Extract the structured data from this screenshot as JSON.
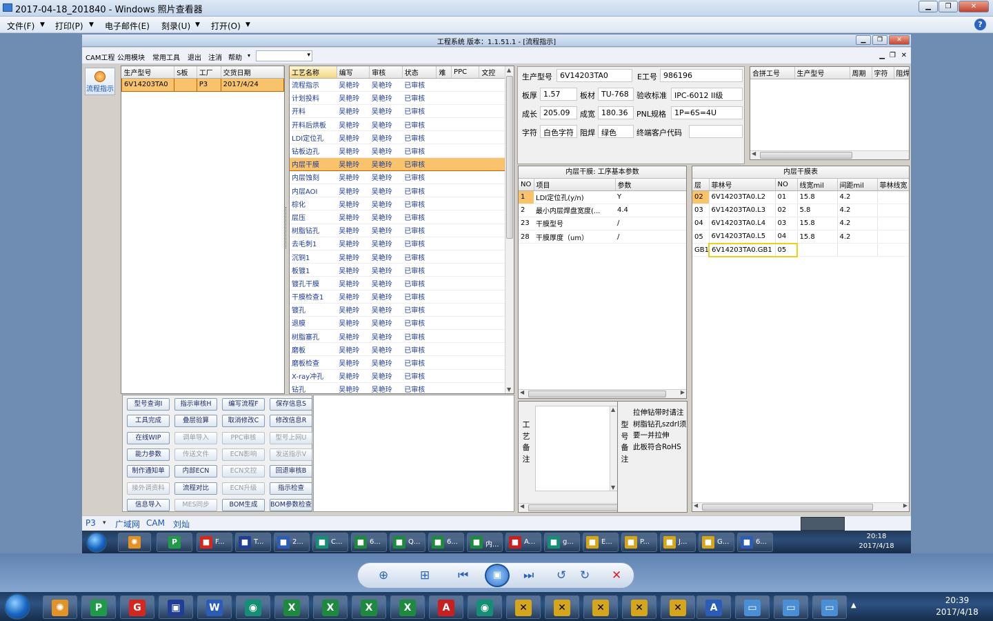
{
  "viewer": {
    "title": "2017-04-18_201840 - Windows 照片查看器",
    "menu": [
      "文件(F)",
      "打印(P)",
      "电子邮件(E)",
      "刻录(U)",
      "打开(O)"
    ]
  },
  "app": {
    "title": "工程系统  版本：1.1.51.1 - [流程指示]",
    "menu": [
      "CAM工程",
      "公用模块",
      "常用工具",
      "退出",
      "注消",
      "帮助"
    ],
    "side_button": "流程指示",
    "order": {
      "headers": [
        "生产型号",
        "S板",
        "工厂",
        "交货日期"
      ],
      "rows": [
        [
          "6V14203TA0",
          "",
          "P3",
          "2017/4/24"
        ]
      ]
    },
    "process": {
      "headers": [
        "工艺名称",
        "编写",
        "审核",
        "状态",
        "难",
        "PPC",
        "文控"
      ],
      "rows": [
        [
          "流程指示",
          "吴艳玲",
          "吴艳玲",
          "已审核"
        ],
        [
          "计划投料",
          "吴艳玲",
          "吴艳玲",
          "已审核"
        ],
        [
          "开料",
          "吴艳玲",
          "吴艳玲",
          "已审核"
        ],
        [
          "开料后烘板",
          "吴艳玲",
          "吴艳玲",
          "已审核"
        ],
        [
          "LDI定位孔",
          "吴艳玲",
          "吴艳玲",
          "已审核"
        ],
        [
          "钻板边孔",
          "吴艳玲",
          "吴艳玲",
          "已审核"
        ],
        [
          "内层干膜",
          "吴艳玲",
          "吴艳玲",
          "已审核"
        ],
        [
          "内层蚀刻",
          "吴艳玲",
          "吴艳玲",
          "已审核"
        ],
        [
          "内层AOI",
          "吴艳玲",
          "吴艳玲",
          "已审核"
        ],
        [
          "棕化",
          "吴艳玲",
          "吴艳玲",
          "已审核"
        ],
        [
          "层压",
          "吴艳玲",
          "吴艳玲",
          "已审核"
        ],
        [
          "树脂钻孔",
          "吴艳玲",
          "吴艳玲",
          "已审核"
        ],
        [
          "去毛刺1",
          "吴艳玲",
          "吴艳玲",
          "已审核"
        ],
        [
          "沉铜1",
          "吴艳玲",
          "吴艳玲",
          "已审核"
        ],
        [
          "板镀1",
          "吴艳玲",
          "吴艳玲",
          "已审核"
        ],
        [
          "镀孔干膜",
          "吴艳玲",
          "吴艳玲",
          "已审核"
        ],
        [
          "干膜检查1",
          "吴艳玲",
          "吴艳玲",
          "已审核"
        ],
        [
          "镀孔",
          "吴艳玲",
          "吴艳玲",
          "已审核"
        ],
        [
          "退膜",
          "吴艳玲",
          "吴艳玲",
          "已审核"
        ],
        [
          "树脂塞孔",
          "吴艳玲",
          "吴艳玲",
          "已审核"
        ],
        [
          "磨板",
          "吴艳玲",
          "吴艳玲",
          "已审核"
        ],
        [
          "磨板检查",
          "吴艳玲",
          "吴艳玲",
          "已审核"
        ],
        [
          "X-ray冲孔",
          "吴艳玲",
          "吴艳玲",
          "已审核"
        ],
        [
          "钻孔",
          "吴艳玲",
          "吴艳玲",
          "已审核"
        ]
      ],
      "selected_index": 6
    },
    "buttons": [
      [
        "型号查询I",
        "指示审核H",
        "编写流程F",
        "保存信息S"
      ],
      [
        "工具完成",
        "叠层验算",
        "取消修改C",
        "修改信息R"
      ],
      [
        "在线WIP",
        "调单导入",
        "PPC审核",
        "型号上网U"
      ],
      [
        "能力参数",
        "传送文件",
        "ECN影响",
        "发送指示V"
      ],
      [
        "制作通知单",
        "内部ECN",
        "ECN文控",
        "回退审核B"
      ],
      [
        "接外调资料",
        "流程对比",
        "ECN升级",
        "指示检查"
      ],
      [
        "信息导入",
        "MES同步",
        "BOM生成",
        "BOM参数检查"
      ]
    ],
    "info": {
      "prod_label": "生产型号",
      "prod": "6V14203TA0",
      "eno_label": "E工号",
      "eno": "986196",
      "thick_label": "板厚",
      "thick": "1.57",
      "mat_label": "板材",
      "mat": "TU-768",
      "std_label": "验收标准",
      "std": "IPC-6012 II级",
      "len_label": "成长",
      "len": "205.09",
      "wid_label": "成宽",
      "wid": "180.36",
      "pnl_label": "PNL规格",
      "pnl": "1P=6S=4U",
      "char_label": "字符",
      "char": "白色字符",
      "mask_label": "阻焊",
      "mask": "绿色",
      "cust_label": "终端客户代码",
      "cust": ""
    },
    "merge": {
      "headers": [
        "合拼工号",
        "生产型号",
        "周期",
        "字符",
        "阻焊"
      ]
    },
    "params": {
      "title": "内层干膜: 工序基本参数",
      "headers": [
        "NO",
        "项目",
        "参数"
      ],
      "rows": [
        [
          "1",
          "LDI定位孔(y/n)",
          "Y"
        ],
        [
          "2",
          "最小内层焊盘宽度(...",
          "4.4"
        ],
        [
          "23",
          "干膜型号",
          "/"
        ],
        [
          "28",
          "干膜厚度（um）",
          "/"
        ]
      ]
    },
    "film": {
      "title": "内层干膜表",
      "headers": [
        "层",
        "菲林号",
        "NO",
        "线宽mil",
        "间距mil",
        "菲林线宽"
      ],
      "rows": [
        [
          "02",
          "6V14203TA0.L2",
          "01",
          "15.8",
          "4.2"
        ],
        [
          "03",
          "6V14203TA0.L3",
          "02",
          "5.8",
          "4.2"
        ],
        [
          "04",
          "6V14203TA0.L4",
          "03",
          "15.8",
          "4.2"
        ],
        [
          "05",
          "6V14203TA0.L5",
          "04",
          "15.8",
          "4.2"
        ],
        [
          "GB1",
          "6V14203TA0.GB1",
          "05",
          "",
          ""
        ]
      ]
    },
    "craft_label": "工\n艺\n备\n注",
    "model_label": "型\n号\n备\n注",
    "model_note": "拉伸钻带时请注\n树脂钻孔szdrl须\n要一并拉伸\n此板符合RoHS",
    "status": {
      "plant": "P3",
      "items": [
        "广域网",
        "CAM",
        "刘灿"
      ]
    },
    "inner_taskbar": [
      {
        "t": "F...",
        "c": "#d6271f"
      },
      {
        "t": "T...",
        "c": "#1f3f96"
      },
      {
        "t": "2...",
        "c": "#2b5cb8"
      },
      {
        "t": "C...",
        "c": "#158f74"
      },
      {
        "t": "6...",
        "c": "#1e8a3e"
      },
      {
        "t": "Q...",
        "c": "#1e8a3e"
      },
      {
        "t": "6...",
        "c": "#1e8a3e"
      },
      {
        "t": "内...",
        "c": "#1e8a3e"
      },
      {
        "t": "A...",
        "c": "#c8201e"
      },
      {
        "t": "g...",
        "c": "#158f74"
      },
      {
        "t": "E...",
        "c": "#d5a61a"
      },
      {
        "t": "P...",
        "c": "#d5a61a"
      },
      {
        "t": "J...",
        "c": "#d5a61a"
      },
      {
        "t": "G...",
        "c": "#d5a61a"
      },
      {
        "t": "6...",
        "c": "#2b5cb8"
      }
    ],
    "inner_clock": {
      "time": "20:18",
      "date": "2017/4/18"
    }
  },
  "clock": {
    "time": "20:39",
    "date": "2017/4/18"
  }
}
